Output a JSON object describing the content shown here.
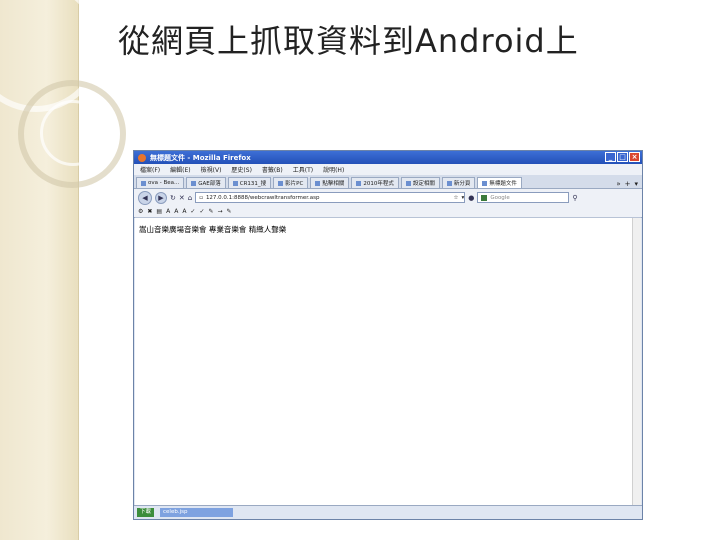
{
  "slide": {
    "title": "從網頁上抓取資料到Android上"
  },
  "browser": {
    "window_title": "無標題文件 - Mozilla Firefox",
    "window_buttons": [
      "_",
      "□",
      "×"
    ],
    "menu": [
      "檔案(F)",
      "編輯(E)",
      "檢視(V)",
      "歷史(S)",
      "書籤(B)",
      "工具(T)",
      "說明(H)"
    ],
    "tabs": [
      {
        "label": "ova - Bea..."
      },
      {
        "label": "GAE部落"
      },
      {
        "label": "CR131_搜"
      },
      {
        "label": "影片PC"
      },
      {
        "label": "點擊相關"
      },
      {
        "label": "2010年程式"
      },
      {
        "label": "設定相關"
      },
      {
        "label": "新分頁"
      },
      {
        "label": "無標題文件",
        "active": true
      }
    ],
    "tab_extras": [
      "»",
      "+",
      "▾"
    ],
    "url": "127.0.0.1:8888/webcrawltransformer.asp",
    "search_placeholder": "Google",
    "content_text": "嵩山音樂廣場音樂會 專業音樂會 精緻人聲樂",
    "status": {
      "start_label": "下載",
      "task_label": "celeb.jsp",
      "right_label": ""
    },
    "icons": {
      "back": "back-arrow-icon",
      "forward": "forward-arrow-icon",
      "reload": "reload-icon",
      "home": "home-icon",
      "search": "magnifier-icon"
    }
  }
}
